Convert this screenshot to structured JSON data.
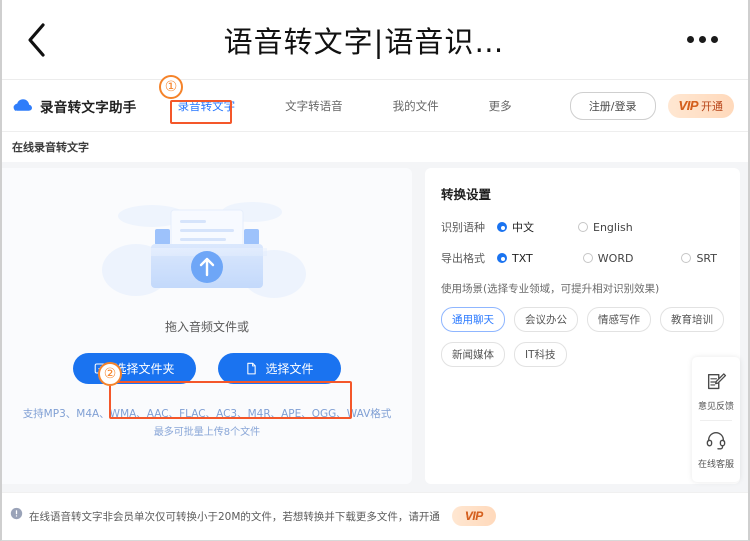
{
  "browser_header": {
    "back_icon": "chevron-left-icon",
    "title": "语音转文字|语音识…",
    "menu_icon": "more-dots-icon"
  },
  "site_nav": {
    "logo_icon": "cloud-icon",
    "brand": "录音转文字助手",
    "items": [
      {
        "label": "录音转文字",
        "active": true
      },
      {
        "label": "文字转语音",
        "active": false
      },
      {
        "label": "我的文件",
        "active": false
      },
      {
        "label": "更多",
        "active": false
      }
    ],
    "login_label": "注册/登录",
    "vip": {
      "word": "VIP",
      "sub": "开通"
    }
  },
  "breadcrumb": "在线录音转文字",
  "upload": {
    "illustration_icon": "upload-folder-icon",
    "drop_text": "拖入音频文件或",
    "folder_button": {
      "label": "选择文件夹",
      "icon": "folder-add-icon"
    },
    "file_button": {
      "label": "选择文件",
      "icon": "file-add-icon"
    },
    "formats": "支持MP3、M4A、WMA、AAC、FLAC、AC3、M4R、APE、OGG、WAV格式",
    "limit": "最多可批量上传8个文件"
  },
  "settings": {
    "title": "转换设置",
    "language": {
      "label": "识别语种",
      "options": [
        {
          "label": "中文",
          "selected": true
        },
        {
          "label": "English",
          "selected": false
        }
      ]
    },
    "format": {
      "label": "导出格式",
      "options": [
        {
          "label": "TXT",
          "selected": true
        },
        {
          "label": "WORD",
          "selected": false
        },
        {
          "label": "SRT",
          "selected": false
        }
      ]
    },
    "scene_hint": "使用场景(选择专业领域，可提升相对识别效果)",
    "scene_tags": [
      {
        "label": "通用聊天",
        "selected": true
      },
      {
        "label": "会议办公",
        "selected": false
      },
      {
        "label": "情感写作",
        "selected": false
      },
      {
        "label": "教育培训",
        "selected": false
      },
      {
        "label": "新闻媒体",
        "selected": false
      },
      {
        "label": "IT科技",
        "selected": false
      }
    ]
  },
  "side_tools": [
    {
      "label": "意见反馈",
      "icon": "feedback-note-icon"
    },
    {
      "label": "在线客服",
      "icon": "headset-icon"
    }
  ],
  "notice": {
    "icon": "info-icon",
    "text": "在线语音转文字非会员单次仅可转换小于20M的文件，若想转换并下载更多文件，请开通",
    "vip": {
      "word": "VIP",
      "sub": ""
    }
  },
  "annotations": [
    {
      "number": "①"
    },
    {
      "number": "②"
    }
  ],
  "colors": {
    "accent_blue": "#1a73f0",
    "nav_active": "#2878ff",
    "annotation_orange": "#f4572a",
    "annotation_circle": "#f5832a",
    "vip_orange": "#d4601f",
    "page_bg": "#f4f5f7"
  }
}
